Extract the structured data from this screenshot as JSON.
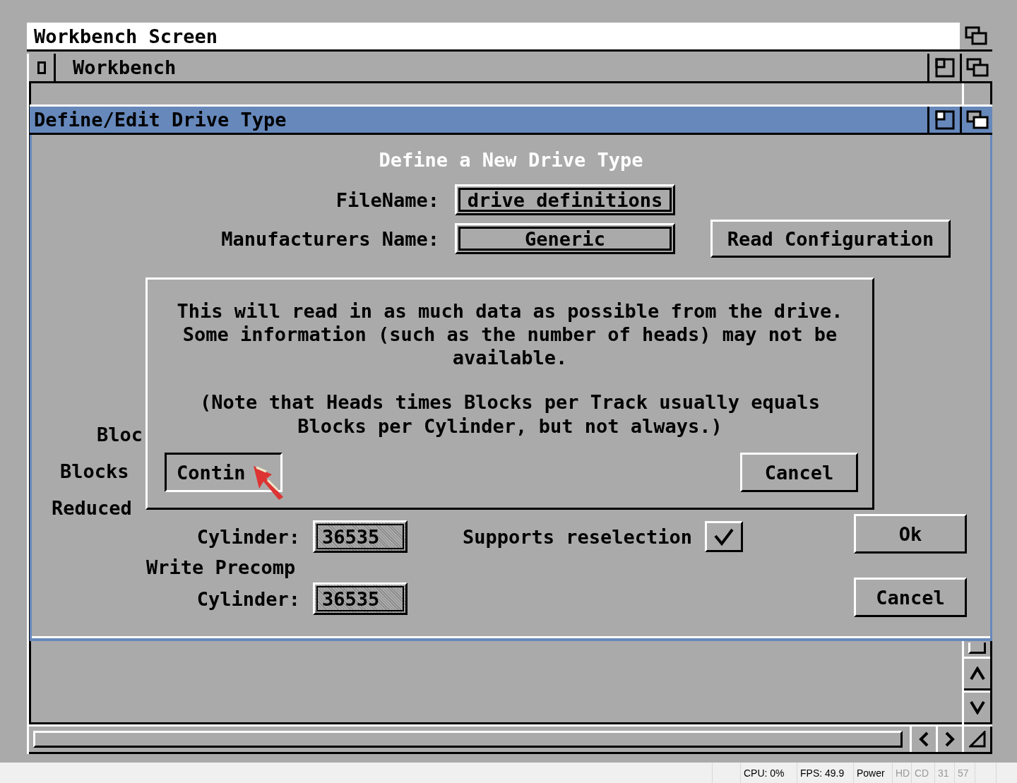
{
  "screen": {
    "title": "Workbench Screen"
  },
  "workbench_window": {
    "title": "Workbench"
  },
  "drive_window": {
    "title": "Define/Edit Drive Type",
    "heading": "Define a New Drive Type",
    "fields": [
      {
        "label": "FileName:",
        "value": "drive definitions"
      },
      {
        "label": "Manufacturers Name:",
        "value": "Generic"
      }
    ],
    "read_button": "Read Configuration",
    "partial_labels": [
      "Bloc",
      "Blocks",
      "Reduced"
    ],
    "cylinder_fields": [
      {
        "label": "Cylinder:",
        "value": "36535"
      },
      {
        "label": "Cylinder:",
        "value": "36535"
      }
    ],
    "precomp_label": "Write Precomp",
    "reselection": {
      "label": "Supports reselection",
      "checked": true
    },
    "buttons": [
      "Ok",
      "Cancel"
    ]
  },
  "requester": {
    "paragraphs": [
      [
        "This will read in as much data as possible from the drive.",
        "Some information (such as the number of heads) may not be",
        "available."
      ],
      [
        "(Note that Heads times Blocks per Track usually equals",
        "Blocks per Cylinder, but not always.)"
      ]
    ],
    "buttons": [
      "Contin",
      "Cancel"
    ]
  },
  "status_bar": [
    {
      "text": "CPU: 0%",
      "active": true
    },
    {
      "text": "FPS: 49.9",
      "active": true
    },
    {
      "text": "Power",
      "active": true
    },
    {
      "text": "HD",
      "active": false
    },
    {
      "text": "CD",
      "active": false
    },
    {
      "text": "31",
      "active": false
    },
    {
      "text": "57",
      "active": false
    }
  ]
}
